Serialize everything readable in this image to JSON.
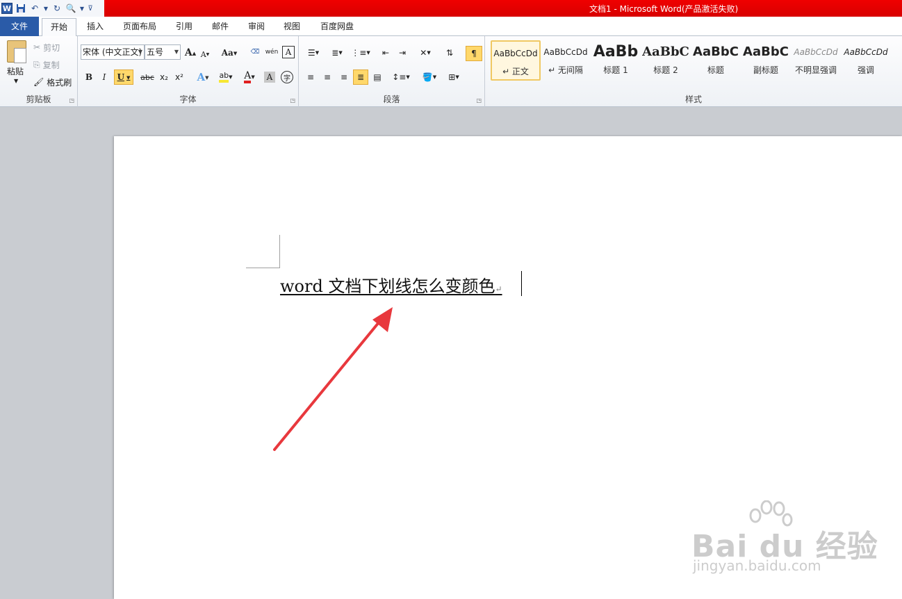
{
  "window": {
    "title": "文档1 - Microsoft Word(产品激活失败)"
  },
  "qat": {
    "app_icon": "W",
    "icons": [
      "save-icon",
      "undo-icon",
      "redo-icon",
      "customize-icon"
    ]
  },
  "tabs": {
    "file": "文件",
    "items": [
      "开始",
      "插入",
      "页面布局",
      "引用",
      "邮件",
      "审阅",
      "视图",
      "百度网盘"
    ],
    "active": "开始"
  },
  "clipboard": {
    "paste": "粘贴",
    "cut": "剪切",
    "copy": "复制",
    "format_painter": "格式刷",
    "label": "剪贴板"
  },
  "font": {
    "font_name": "宋体 (中文正文)",
    "font_size": "五号",
    "grow": "A",
    "shrink": "A",
    "change_case": "Aa",
    "pinyin": "wén",
    "bold": "B",
    "italic": "I",
    "underline": "U",
    "strike": "abc",
    "subscript": "x₂",
    "superscript": "x²",
    "highlight": "ab",
    "font_color": "A",
    "shading": "A",
    "enclose": "字",
    "label": "字体"
  },
  "paragraph": {
    "label": "段落"
  },
  "styles": {
    "label": "样式",
    "items": [
      {
        "sample": "AaBbCcDd",
        "name": "↵ 正文"
      },
      {
        "sample": "AaBbCcDd",
        "name": "↵ 无间隔"
      },
      {
        "sample": "AaBb",
        "name": "标题 1"
      },
      {
        "sample": "AaBbC",
        "name": "标题 2"
      },
      {
        "sample": "AaBbC",
        "name": "标题"
      },
      {
        "sample": "AaBbC",
        "name": "副标题"
      },
      {
        "sample": "AaBbCcDd",
        "name": "不明显强调"
      },
      {
        "sample": "AaBbCcDd",
        "name": "强调"
      }
    ]
  },
  "document": {
    "text": "word 文档下划线怎么变颜色",
    "paragraph_mark": "↵"
  },
  "colors": {
    "title_bar": "#e00000",
    "file_tab": "#2a5ba8",
    "arrow": "#e8383d",
    "highlight_yellow": "#f7e733",
    "font_red": "#e02020"
  },
  "watermark": {
    "main": "Bai du 经验",
    "sub": "jingyan.baidu.com"
  }
}
